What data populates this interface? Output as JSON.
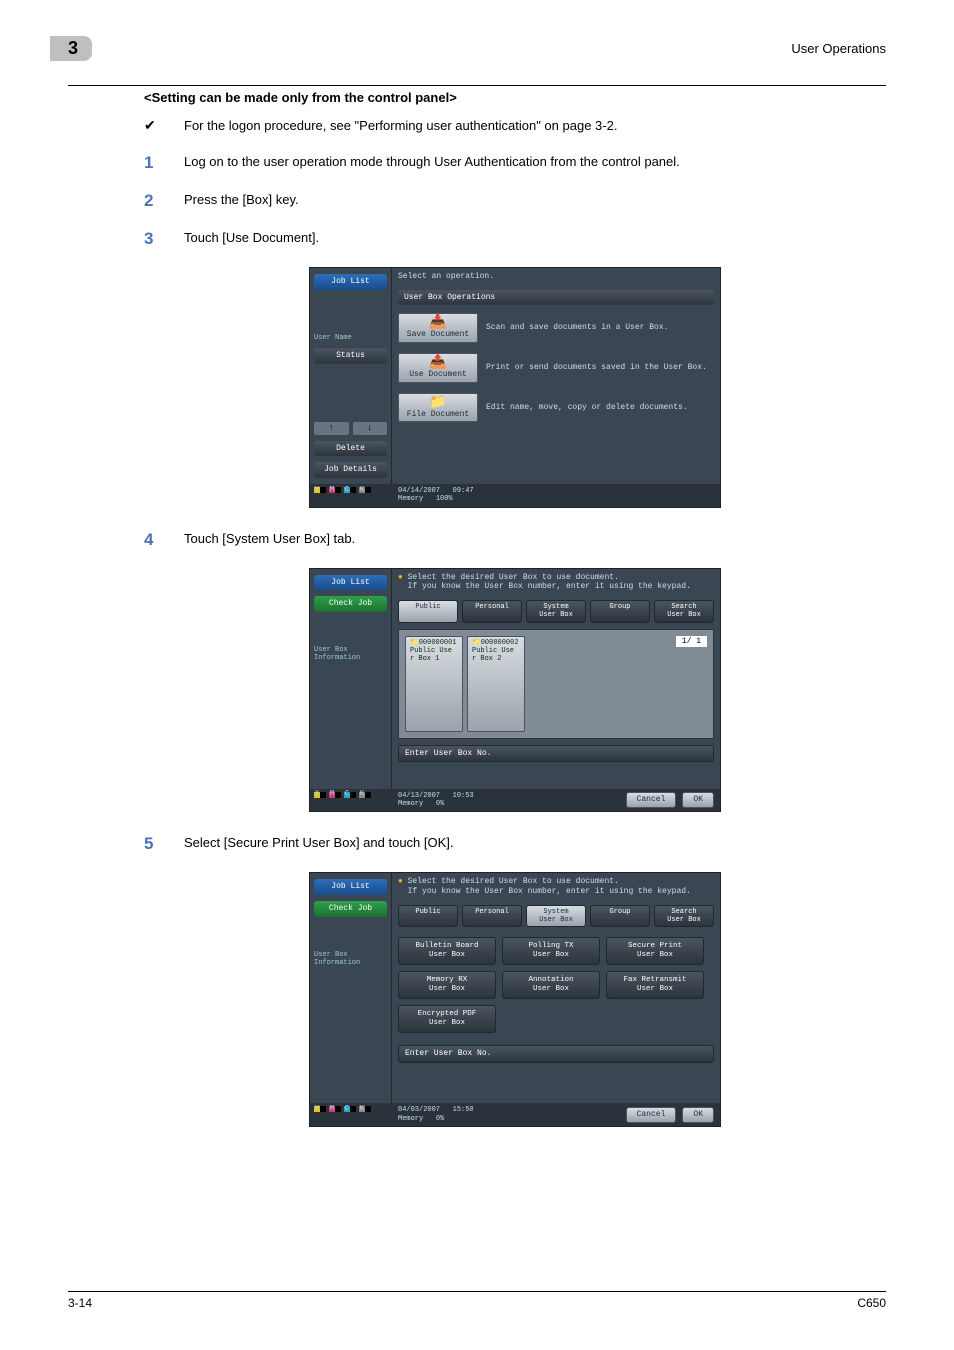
{
  "header": {
    "chapter_num": "3",
    "section_title": "User Operations"
  },
  "subheading": "<Setting can be made only from the control panel>",
  "bullet": {
    "text": "For the logon procedure, see \"Performing user authentication\" on page 3-2."
  },
  "steps": {
    "s1": {
      "num": "1",
      "text": "Log on to the user operation mode through User Authentication from the control panel."
    },
    "s2": {
      "num": "2",
      "text": "Press the [Box] key."
    },
    "s3": {
      "num": "3",
      "text": "Touch [Use Document]."
    },
    "s4": {
      "num": "4",
      "text": "Touch [System User Box] tab."
    },
    "s5": {
      "num": "5",
      "text": "Select [Secure Print User Box] and touch [OK]."
    }
  },
  "panel1": {
    "side": {
      "job_list": "Job List",
      "user_name_lbl": "User\nName",
      "status": "Status",
      "delete": "Delete",
      "job_details": "Job Details"
    },
    "hdr": "Select an operation.",
    "subbar": "User Box Operations",
    "ops": [
      {
        "btn": "Save Document",
        "desc": "Scan and save documents in a User Box."
      },
      {
        "btn": "Use Document",
        "desc": "Print or send documents saved in the User Box."
      },
      {
        "btn": "File Document",
        "desc": "Edit name, move, copy or delete documents."
      }
    ],
    "footer": {
      "date": "04/14/2007",
      "time": "09:47",
      "mem_lbl": "Memory",
      "mem_val": "100%"
    }
  },
  "panel2": {
    "side": {
      "job_list": "Job List",
      "check_job": "Check Job",
      "user_box_info": "User Box\nInformation"
    },
    "hdr1": "Select the desired User Box to use document.",
    "hdr2": "If you know the User Box number, enter it using the keypad.",
    "tabs": [
      "Public",
      "Personal",
      "System\nUser Box",
      "Group",
      "Search\nUser Box"
    ],
    "selected_tab": 0,
    "boxes": [
      {
        "num": "000000001",
        "name": "Public Use\nr Box 1"
      },
      {
        "num": "000000002",
        "name": "Public Use\nr Box 2"
      }
    ],
    "pager": "1/ 1",
    "enter_btn": "Enter User Box No.",
    "cancel": "Cancel",
    "ok": "OK",
    "footer": {
      "date": "04/13/2007",
      "time": "10:53",
      "mem_lbl": "Memory",
      "mem_val": "0%"
    }
  },
  "panel3": {
    "side": {
      "job_list": "Job List",
      "check_job": "Check Job",
      "user_box_info": "User Box\nInformation"
    },
    "hdr1": "Select the desired User Box to use document.",
    "hdr2": "If you know the User Box number, enter it using the keypad.",
    "tabs": [
      "Public",
      "Personal",
      "System\nUser Box",
      "Group",
      "Search\nUser Box"
    ],
    "selected_tab": 2,
    "sys_boxes": [
      "Bulletin Board\nUser Box",
      "Polling TX\nUser Box",
      "Secure Print\nUser Box",
      "Memory RX\nUser Box",
      "Annotation\nUser Box",
      "Fax Retransmit\nUser Box",
      "Encrypted PDF\nUser Box"
    ],
    "enter_btn": "Enter User Box No.",
    "cancel": "Cancel",
    "ok": "OK",
    "footer": {
      "date": "04/03/2007",
      "time": "15:50",
      "mem_lbl": "Memory",
      "mem_val": "0%"
    }
  },
  "toner_labels": [
    "Y",
    "M",
    "C",
    "K"
  ],
  "page_footer": {
    "left": "3-14",
    "right": "C650"
  }
}
